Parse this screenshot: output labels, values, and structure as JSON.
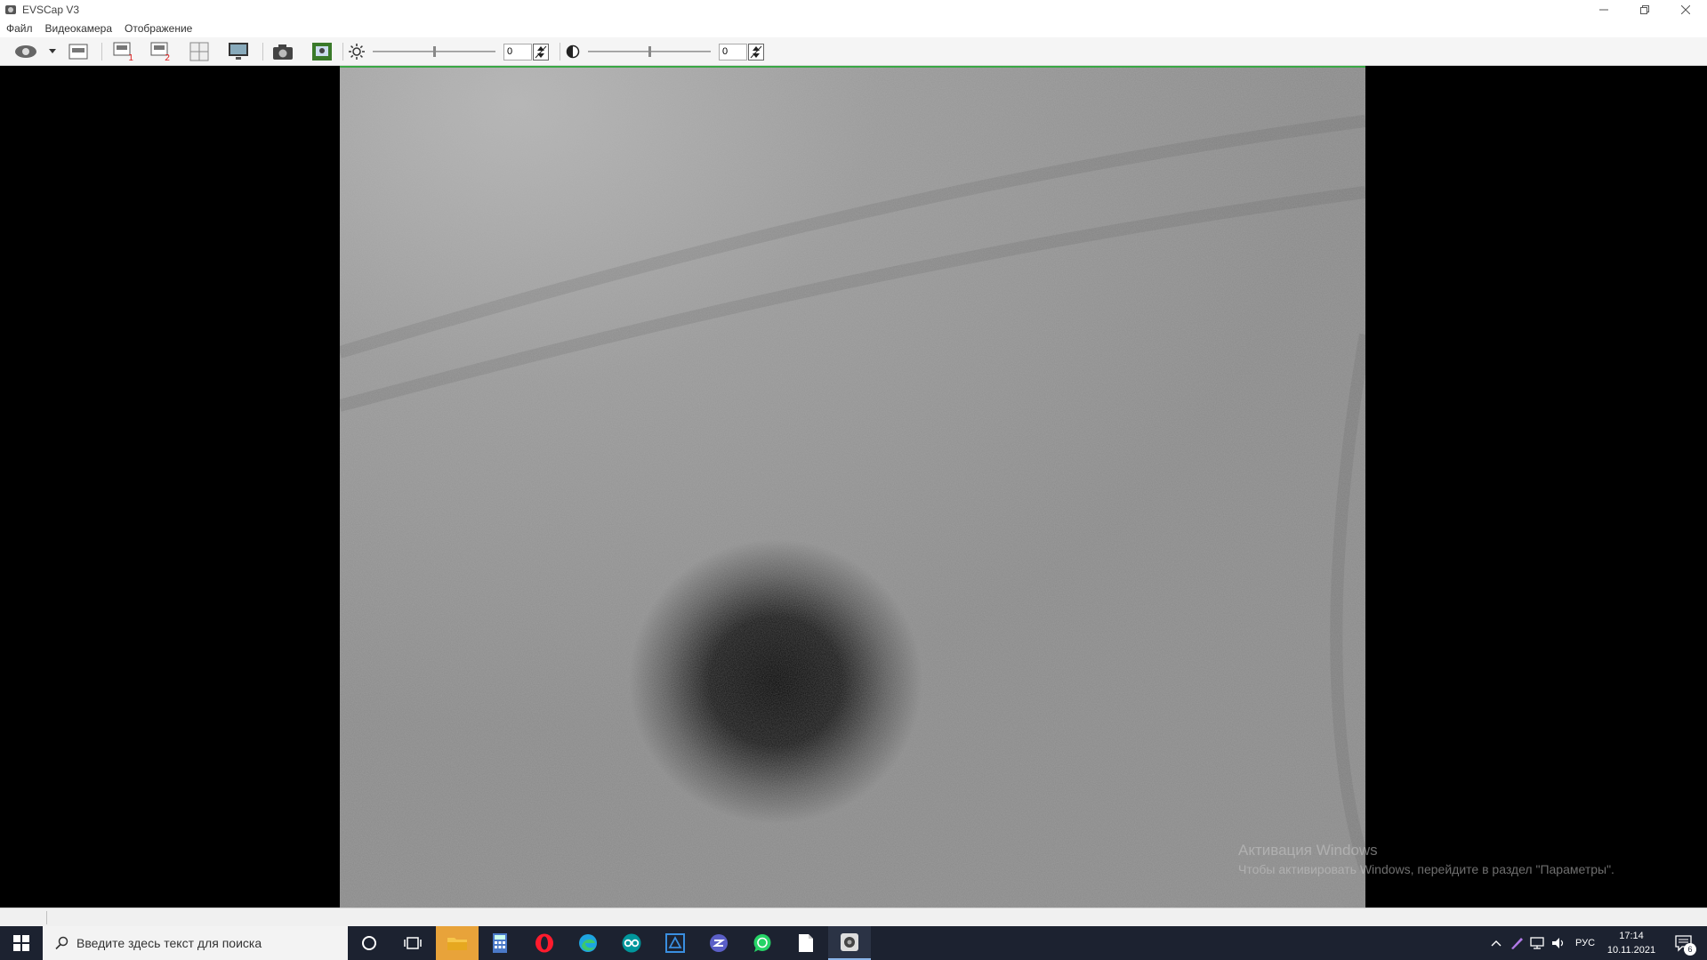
{
  "window": {
    "title": "EVSCap V3"
  },
  "menu": {
    "items": [
      "Файл",
      "Видеокамера",
      "Отображение"
    ]
  },
  "toolbar": {
    "brightness": {
      "value": "0",
      "level": 0.5
    },
    "contrast": {
      "value": "0",
      "level": 0.5
    }
  },
  "watermark": {
    "title": "Активация Windows",
    "subtitle": "Чтобы активировать Windows, перейдите в раздел \"Параметры\"."
  },
  "taskbar": {
    "search_placeholder": "Введите здесь текст для поиска",
    "language": "РУС",
    "time": "17:14",
    "date": "10.11.2021",
    "notification_count": "6"
  },
  "colors": {
    "taskbar": "#1c2230",
    "accent_green": "#3aa845",
    "active_app": "#e8a33a"
  }
}
